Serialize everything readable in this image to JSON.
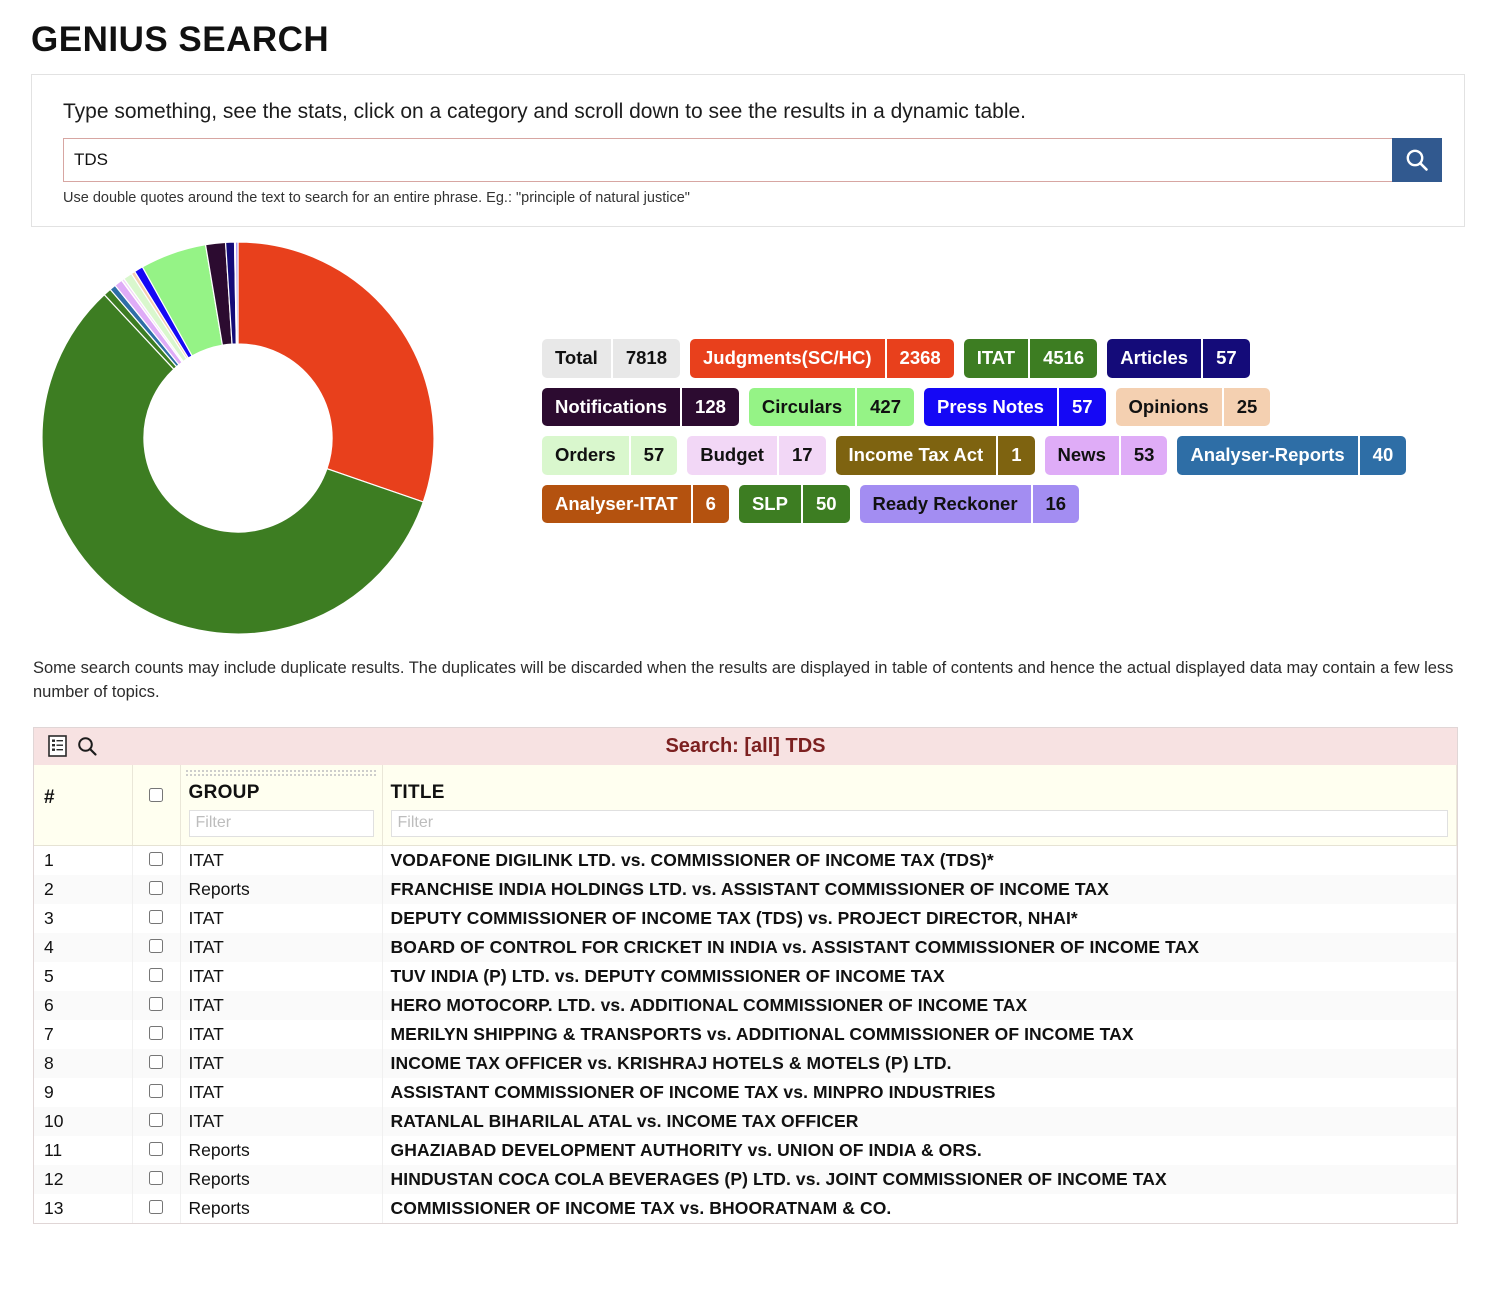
{
  "page_title": "GENIUS SEARCH",
  "search": {
    "hint": "Type something, see the stats, click on a category and scroll down to see the results in a dynamic table.",
    "value": "TDS",
    "placeholder": "",
    "note": "Use double quotes around the text to search for an entire phrase. Eg.: \"principle of natural justice\"",
    "button_icon": "search-icon"
  },
  "disclaimer": "Some search counts may include duplicate results. The duplicates will be discarded when the results are displayed in table of contents and hence the actual displayed data may contain a few less number of topics.",
  "badges": [
    {
      "label": "Total",
      "count": "7818",
      "bg": "#e8e8e8",
      "fg": "#111111",
      "count_bg": "#e8e8e8",
      "count_fg": "#111111"
    },
    {
      "label": "Judgments(SC/HC)",
      "count": "2368",
      "bg": "#e8401c",
      "fg": "#ffffff",
      "count_bg": "#e8401c",
      "count_fg": "#ffffff"
    },
    {
      "label": "ITAT",
      "count": "4516",
      "bg": "#3d7d22",
      "fg": "#ffffff",
      "count_bg": "#3d7d22",
      "count_fg": "#ffffff"
    },
    {
      "label": "Articles",
      "count": "57",
      "bg": "#140b79",
      "fg": "#ffffff",
      "count_bg": "#140b79",
      "count_fg": "#ffffff"
    },
    {
      "label": "Notifications",
      "count": "128",
      "bg": "#2c0b30",
      "fg": "#ffffff",
      "count_bg": "#2c0b30",
      "count_fg": "#ffffff"
    },
    {
      "label": "Circulars",
      "count": "427",
      "bg": "#95f386",
      "fg": "#111111",
      "count_bg": "#95f386",
      "count_fg": "#111111"
    },
    {
      "label": "Press Notes",
      "count": "57",
      "bg": "#1508f5",
      "fg": "#ffffff",
      "count_bg": "#1508f5",
      "count_fg": "#ffffff"
    },
    {
      "label": "Opinions",
      "count": "25",
      "bg": "#f4d0b1",
      "fg": "#111111",
      "count_bg": "#f4d0b1",
      "count_fg": "#111111"
    },
    {
      "label": "Orders",
      "count": "57",
      "bg": "#d9f7cd",
      "fg": "#111111",
      "count_bg": "#d9f7cd",
      "count_fg": "#111111"
    },
    {
      "label": "Budget",
      "count": "17",
      "bg": "#f2d7f6",
      "fg": "#111111",
      "count_bg": "#f2d7f6",
      "count_fg": "#111111"
    },
    {
      "label": "Income Tax Act",
      "count": "1",
      "bg": "#7e6310",
      "fg": "#ffffff",
      "count_bg": "#7e6310",
      "count_fg": "#ffffff"
    },
    {
      "label": "News",
      "count": "53",
      "bg": "#dfacf7",
      "fg": "#111111",
      "count_bg": "#dfacf7",
      "count_fg": "#111111"
    },
    {
      "label": "Analyser-Reports",
      "count": "40",
      "bg": "#2e6ea6",
      "fg": "#ffffff",
      "count_bg": "#2e6ea6",
      "count_fg": "#ffffff"
    },
    {
      "label": "Analyser-ITAT",
      "count": "6",
      "bg": "#b4520f",
      "fg": "#ffffff",
      "count_bg": "#b4520f",
      "count_fg": "#ffffff"
    },
    {
      "label": "SLP",
      "count": "50",
      "bg": "#3d7d22",
      "fg": "#ffffff",
      "count_bg": "#3d7d22",
      "count_fg": "#ffffff"
    },
    {
      "label": "Ready Reckoner",
      "count": "16",
      "bg": "#a38df2",
      "fg": "#111111",
      "count_bg": "#a38df2",
      "count_fg": "#111111"
    }
  ],
  "chart_data": {
    "type": "pie",
    "title": "",
    "subtitle": "",
    "xlabel": "",
    "ylabel": "",
    "legend_position": "right",
    "grid": false,
    "donut": true,
    "inner_radius_ratio": 0.48,
    "start_angle_deg": 0,
    "direction": "clockwise",
    "total": 7818,
    "categories": [
      "Judgments(SC/HC)",
      "ITAT",
      "SLP",
      "Analyser-Reports",
      "News",
      "Income Tax Act",
      "Budget",
      "Orders",
      "Opinions",
      "Press Notes",
      "Circulars",
      "Notifications",
      "Articles",
      "Analyser-ITAT",
      "Ready Reckoner"
    ],
    "values": [
      2368,
      4516,
      50,
      40,
      53,
      1,
      17,
      57,
      25,
      57,
      427,
      128,
      57,
      6,
      16
    ],
    "colors": [
      "#e8401c",
      "#3d7d22",
      "#3d7d22",
      "#2e6ea6",
      "#dfacf7",
      "#7e6310",
      "#f2d7f6",
      "#d9f7cd",
      "#f4d0b1",
      "#1508f5",
      "#95f386",
      "#2c0b30",
      "#140b79",
      "#b4520f",
      "#a38df2"
    ]
  },
  "results_table": {
    "title": "Search: [all] TDS",
    "toolbar": {
      "list_icon": "list-view-icon",
      "search_icon": "search-icon"
    },
    "columns": [
      {
        "key": "num",
        "label": "#"
      },
      {
        "key": "chk",
        "label": ""
      },
      {
        "key": "group",
        "label": "GROUP",
        "filter_placeholder": "Filter"
      },
      {
        "key": "title",
        "label": "TITLE",
        "filter_placeholder": "Filter"
      }
    ],
    "rows": [
      {
        "num": "1",
        "group": "ITAT",
        "title": "VODAFONE DIGILINK LTD. vs. COMMISSIONER OF INCOME TAX (TDS)*"
      },
      {
        "num": "2",
        "group": "Reports",
        "title": "FRANCHISE INDIA HOLDINGS LTD. vs. ASSISTANT COMMISSIONER OF INCOME TAX"
      },
      {
        "num": "3",
        "group": "ITAT",
        "title": "DEPUTY COMMISSIONER OF INCOME TAX (TDS) vs. PROJECT DIRECTOR, NHAI*"
      },
      {
        "num": "4",
        "group": "ITAT",
        "title": "BOARD OF CONTROL FOR CRICKET IN INDIA vs. ASSISTANT COMMISSIONER OF INCOME TAX"
      },
      {
        "num": "5",
        "group": "ITAT",
        "title": "TUV INDIA (P) LTD. vs. DEPUTY COMMISSIONER OF INCOME TAX"
      },
      {
        "num": "6",
        "group": "ITAT",
        "title": "HERO MOTOCORP. LTD. vs. ADDITIONAL COMMISSIONER OF INCOME TAX"
      },
      {
        "num": "7",
        "group": "ITAT",
        "title": "MERILYN SHIPPING & TRANSPORTS vs. ADDITIONAL COMMISSIONER OF INCOME TAX"
      },
      {
        "num": "8",
        "group": "ITAT",
        "title": "INCOME TAX OFFICER vs. KRISHRAJ HOTELS & MOTELS (P) LTD."
      },
      {
        "num": "9",
        "group": "ITAT",
        "title": "ASSISTANT COMMISSIONER OF INCOME TAX vs. MINPRO INDUSTRIES"
      },
      {
        "num": "10",
        "group": "ITAT",
        "title": "RATANLAL BIHARILAL ATAL vs. INCOME TAX OFFICER"
      },
      {
        "num": "11",
        "group": "Reports",
        "title": "GHAZIABAD DEVELOPMENT AUTHORITY vs. UNION OF INDIA & ORS."
      },
      {
        "num": "12",
        "group": "Reports",
        "title": "HINDUSTAN COCA COLA BEVERAGES (P) LTD. vs. JOINT COMMISSIONER OF INCOME TAX"
      },
      {
        "num": "13",
        "group": "Reports",
        "title": "COMMISSIONER OF INCOME TAX vs. BHOORATNAM & CO."
      }
    ]
  }
}
